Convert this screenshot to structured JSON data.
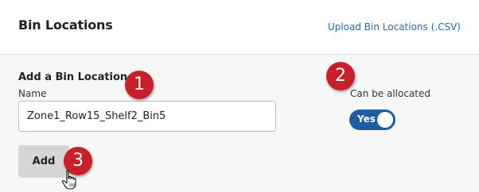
{
  "header": {
    "title": "Bin Locations",
    "upload_link": "Upload Bin Locations (.CSV)"
  },
  "form": {
    "section_title": "Add a Bin Location",
    "name_label": "Name",
    "name_value": "Zone1_Row15_Shelf2_Bin5",
    "add_button": "Add"
  },
  "allocation": {
    "label": "Can be allocated",
    "toggle_text": "Yes",
    "toggle_on": true
  },
  "annotations": {
    "step1": "1",
    "step2": "2",
    "step3": "3"
  },
  "colors": {
    "link": "#1f6ab3",
    "toggle_on": "#1f5da3",
    "badge": "#c8202b",
    "button": "#d6d6d6"
  },
  "icons": {
    "cursor": "hand-pointer-icon"
  }
}
